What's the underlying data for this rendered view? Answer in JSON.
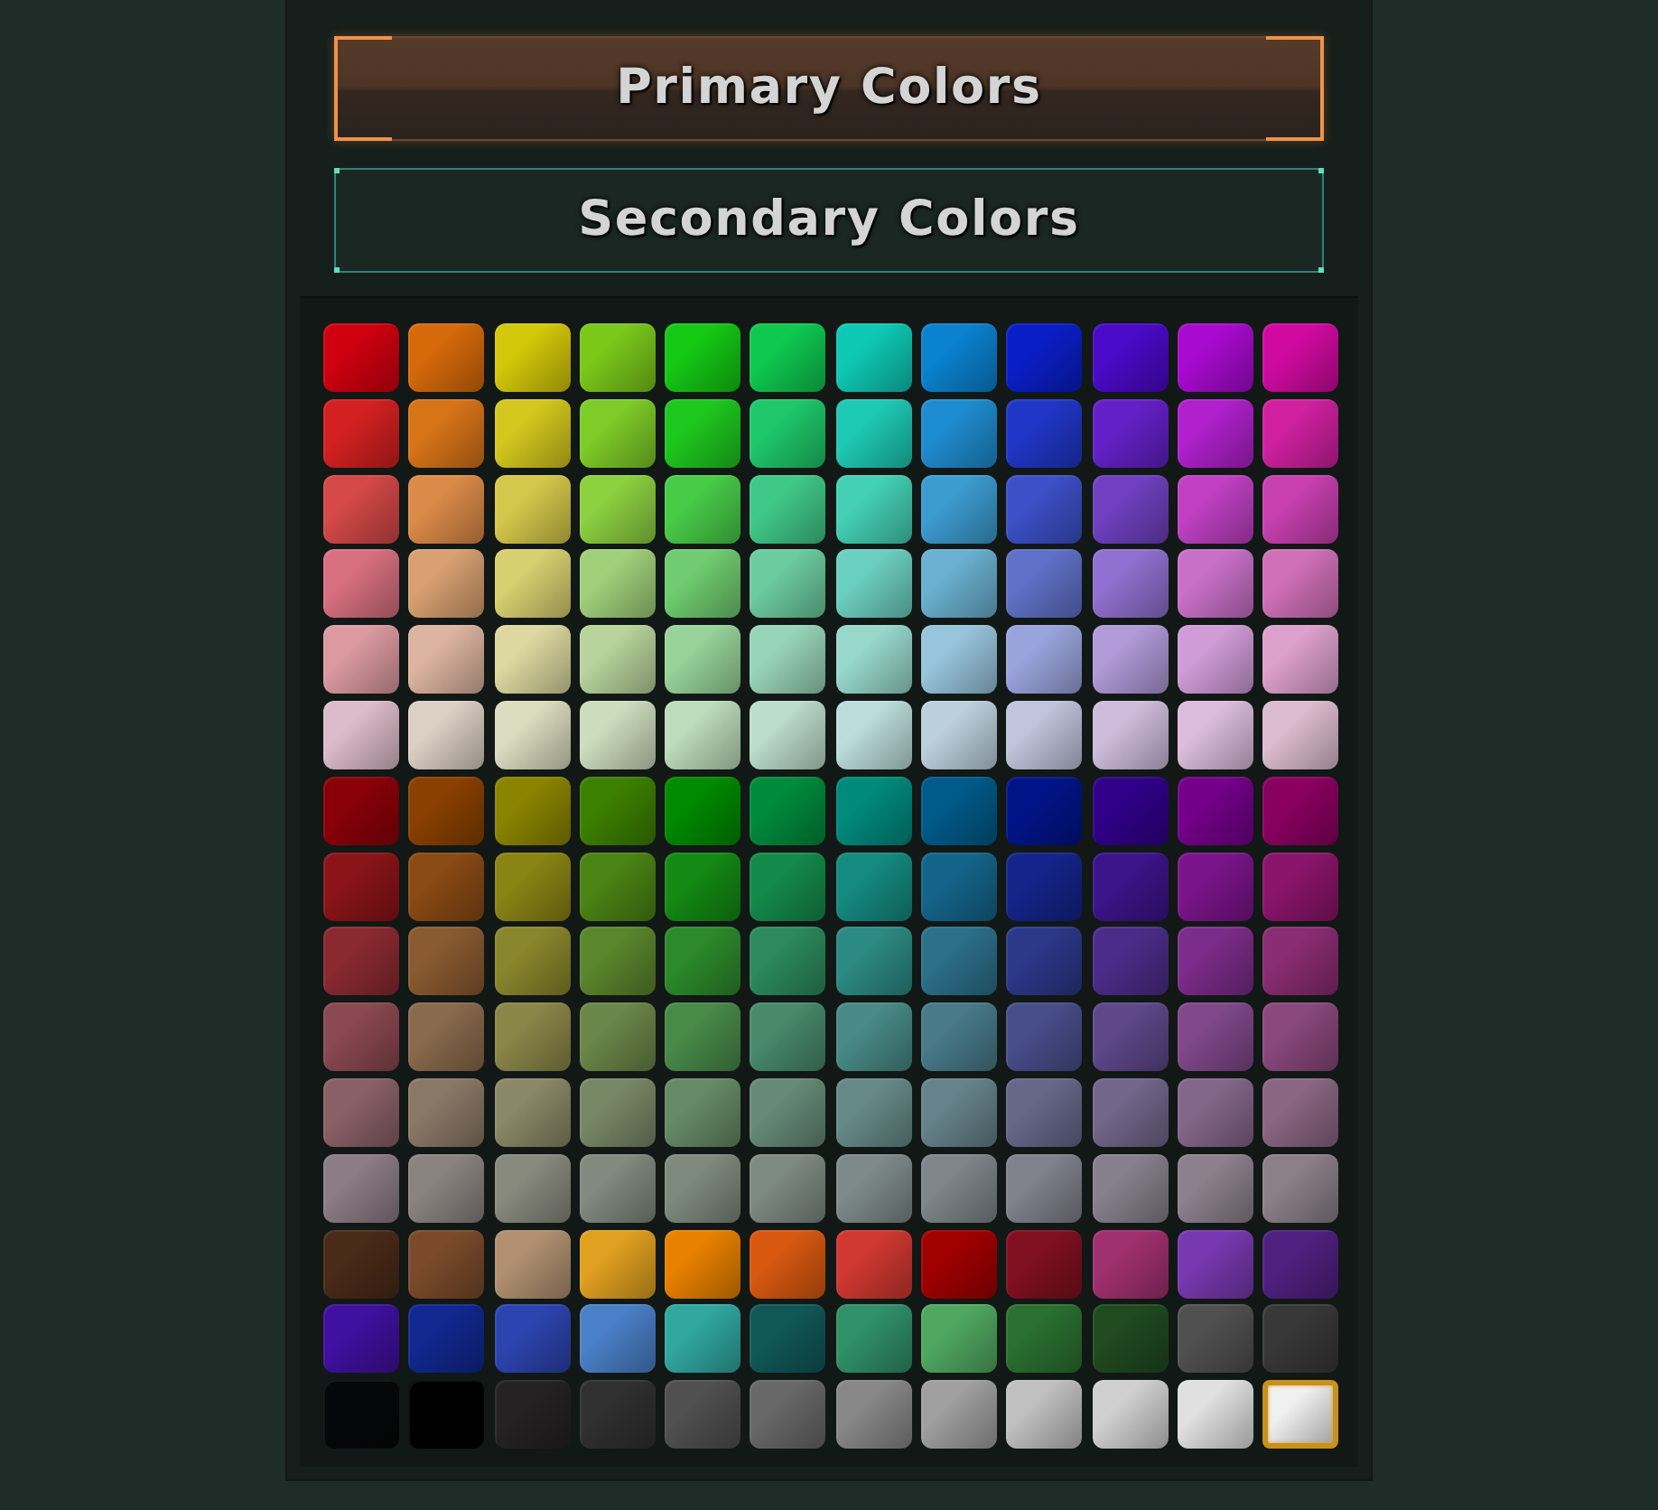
{
  "tabs": [
    {
      "label": "Primary Colors",
      "selected": true
    },
    {
      "label": "Secondary Colors",
      "selected": false
    }
  ],
  "swatches": [
    {
      "color": "#d0000f",
      "selected": false
    },
    {
      "color": "#d66a0a",
      "selected": false
    },
    {
      "color": "#d4c80a",
      "selected": false
    },
    {
      "color": "#7ac81a",
      "selected": false
    },
    {
      "color": "#14c814",
      "selected": false
    },
    {
      "color": "#0ec850",
      "selected": false
    },
    {
      "color": "#0ec8b4",
      "selected": false
    },
    {
      "color": "#0a82d0",
      "selected": false
    },
    {
      "color": "#0a1ec8",
      "selected": false
    },
    {
      "color": "#4a0ac8",
      "selected": false
    },
    {
      "color": "#a80ad0",
      "selected": false
    },
    {
      "color": "#d00aa0",
      "selected": false
    },
    {
      "color": "#d42020",
      "selected": false
    },
    {
      "color": "#d87418",
      "selected": false
    },
    {
      "color": "#d4c81e",
      "selected": false
    },
    {
      "color": "#7ecc28",
      "selected": false
    },
    {
      "color": "#1ec81e",
      "selected": false
    },
    {
      "color": "#1ec86a",
      "selected": false
    },
    {
      "color": "#1ecab4",
      "selected": false
    },
    {
      "color": "#1e8cd0",
      "selected": false
    },
    {
      "color": "#2036c8",
      "selected": false
    },
    {
      "color": "#6420c8",
      "selected": false
    },
    {
      "color": "#b020cc",
      "selected": false
    },
    {
      "color": "#d020a0",
      "selected": false
    },
    {
      "color": "#d44848",
      "selected": false
    },
    {
      "color": "#dc8a48",
      "selected": false
    },
    {
      "color": "#d4c84a",
      "selected": false
    },
    {
      "color": "#8cd040",
      "selected": false
    },
    {
      "color": "#48cc48",
      "selected": false
    },
    {
      "color": "#40c888",
      "selected": false
    },
    {
      "color": "#44d0b4",
      "selected": false
    },
    {
      "color": "#3c9cd0",
      "selected": false
    },
    {
      "color": "#3c50c8",
      "selected": false
    },
    {
      "color": "#7040c0",
      "selected": false
    },
    {
      "color": "#c040c4",
      "selected": false
    },
    {
      "color": "#c840b0",
      "selected": false
    },
    {
      "color": "#d87080",
      "selected": false
    },
    {
      "color": "#d8a070",
      "selected": false
    },
    {
      "color": "#d8d070",
      "selected": false
    },
    {
      "color": "#a0d07a",
      "selected": false
    },
    {
      "color": "#70cc70",
      "selected": false
    },
    {
      "color": "#6ccca0",
      "selected": false
    },
    {
      "color": "#6cd0c0",
      "selected": false
    },
    {
      "color": "#6ab0d0",
      "selected": false
    },
    {
      "color": "#6070c8",
      "selected": false
    },
    {
      "color": "#9070d0",
      "selected": false
    },
    {
      "color": "#c870c8",
      "selected": false
    },
    {
      "color": "#d070b8",
      "selected": false
    },
    {
      "color": "#dc9aa0",
      "selected": false
    },
    {
      "color": "#dcb4a0",
      "selected": false
    },
    {
      "color": "#dcd8a0",
      "selected": false
    },
    {
      "color": "#b8d49c",
      "selected": false
    },
    {
      "color": "#98d49a",
      "selected": false
    },
    {
      "color": "#98d4b8",
      "selected": false
    },
    {
      "color": "#98d8cc",
      "selected": false
    },
    {
      "color": "#98c4dc",
      "selected": false
    },
    {
      "color": "#9aa4dc",
      "selected": false
    },
    {
      "color": "#b09ad8",
      "selected": false
    },
    {
      "color": "#d09cd8",
      "selected": false
    },
    {
      "color": "#dca0cc",
      "selected": false
    },
    {
      "color": "#dcbcc8",
      "selected": false
    },
    {
      "color": "#dcd0c4",
      "selected": false
    },
    {
      "color": "#dcdcc0",
      "selected": false
    },
    {
      "color": "#ccdcbc",
      "selected": false
    },
    {
      "color": "#bcdcbc",
      "selected": false
    },
    {
      "color": "#bcdccc",
      "selected": false
    },
    {
      "color": "#bcdcdc",
      "selected": false
    },
    {
      "color": "#bcd0dc",
      "selected": false
    },
    {
      "color": "#c0c4dc",
      "selected": false
    },
    {
      "color": "#cebcdc",
      "selected": false
    },
    {
      "color": "#dcbcdc",
      "selected": false
    },
    {
      "color": "#dcbcd0",
      "selected": false
    },
    {
      "color": "#8a0008",
      "selected": false
    },
    {
      "color": "#8a4000",
      "selected": false
    },
    {
      "color": "#8a8400",
      "selected": false
    },
    {
      "color": "#3c8000",
      "selected": false
    },
    {
      "color": "#008a00",
      "selected": false
    },
    {
      "color": "#008a3c",
      "selected": false
    },
    {
      "color": "#008a7c",
      "selected": false
    },
    {
      "color": "#005a8a",
      "selected": false
    },
    {
      "color": "#001488",
      "selected": false
    },
    {
      "color": "#300088",
      "selected": false
    },
    {
      "color": "#74008a",
      "selected": false
    },
    {
      "color": "#8a0060",
      "selected": false
    },
    {
      "color": "#8a1418",
      "selected": false
    },
    {
      "color": "#8a4a14",
      "selected": false
    },
    {
      "color": "#8a8414",
      "selected": false
    },
    {
      "color": "#4a8414",
      "selected": false
    },
    {
      "color": "#148a14",
      "selected": false
    },
    {
      "color": "#148a4a",
      "selected": false
    },
    {
      "color": "#148a80",
      "selected": false
    },
    {
      "color": "#14648a",
      "selected": false
    },
    {
      "color": "#14248a",
      "selected": false
    },
    {
      "color": "#3c148a",
      "selected": false
    },
    {
      "color": "#7a148a",
      "selected": false
    },
    {
      "color": "#8a146a",
      "selected": false
    },
    {
      "color": "#8a2a30",
      "selected": false
    },
    {
      "color": "#8a5a30",
      "selected": false
    },
    {
      "color": "#8a862c",
      "selected": false
    },
    {
      "color": "#5a862c",
      "selected": false
    },
    {
      "color": "#2c8a2c",
      "selected": false
    },
    {
      "color": "#2c8a5c",
      "selected": false
    },
    {
      "color": "#2c8a84",
      "selected": false
    },
    {
      "color": "#2c708a",
      "selected": false
    },
    {
      "color": "#2c388a",
      "selected": false
    },
    {
      "color": "#4c2c8a",
      "selected": false
    },
    {
      "color": "#7c2c8a",
      "selected": false
    },
    {
      "color": "#8a2c72",
      "selected": false
    },
    {
      "color": "#8a4850",
      "selected": false
    },
    {
      "color": "#8a6a4c",
      "selected": false
    },
    {
      "color": "#8a8648",
      "selected": false
    },
    {
      "color": "#6a8648",
      "selected": false
    },
    {
      "color": "#488a48",
      "selected": false
    },
    {
      "color": "#488a6a",
      "selected": false
    },
    {
      "color": "#488a86",
      "selected": false
    },
    {
      "color": "#487a8a",
      "selected": false
    },
    {
      "color": "#484e8a",
      "selected": false
    },
    {
      "color": "#5e488a",
      "selected": false
    },
    {
      "color": "#80488a",
      "selected": false
    },
    {
      "color": "#8a487c",
      "selected": false
    },
    {
      "color": "#8a6068",
      "selected": false
    },
    {
      "color": "#8a7866",
      "selected": false
    },
    {
      "color": "#8a8866",
      "selected": false
    },
    {
      "color": "#788866",
      "selected": false
    },
    {
      "color": "#668a66",
      "selected": false
    },
    {
      "color": "#668a78",
      "selected": false
    },
    {
      "color": "#668a88",
      "selected": false
    },
    {
      "color": "#66828a",
      "selected": false
    },
    {
      "color": "#66688a",
      "selected": false
    },
    {
      "color": "#72668a",
      "selected": false
    },
    {
      "color": "#84668a",
      "selected": false
    },
    {
      "color": "#8a6682",
      "selected": false
    },
    {
      "color": "#8c7c84",
      "selected": false
    },
    {
      "color": "#8a8480",
      "selected": false
    },
    {
      "color": "#888a7e",
      "selected": false
    },
    {
      "color": "#808a7e",
      "selected": false
    },
    {
      "color": "#7e8a7e",
      "selected": false
    },
    {
      "color": "#7e8a84",
      "selected": false
    },
    {
      "color": "#7e8a8a",
      "selected": false
    },
    {
      "color": "#7e868a",
      "selected": false
    },
    {
      "color": "#80828c",
      "selected": false
    },
    {
      "color": "#86808c",
      "selected": false
    },
    {
      "color": "#8c808c",
      "selected": false
    },
    {
      "color": "#8c8088",
      "selected": false
    },
    {
      "color": "#4a2a18",
      "selected": false
    },
    {
      "color": "#7a4a2a",
      "selected": false
    },
    {
      "color": "#b09070",
      "selected": false
    },
    {
      "color": "#e0a020",
      "selected": false
    },
    {
      "color": "#e88000",
      "selected": false
    },
    {
      "color": "#d85810",
      "selected": false
    },
    {
      "color": "#d03830",
      "selected": false
    },
    {
      "color": "#a00000",
      "selected": false
    },
    {
      "color": "#801020",
      "selected": false
    },
    {
      "color": "#a03070",
      "selected": false
    },
    {
      "color": "#7838b0",
      "selected": false
    },
    {
      "color": "#502080",
      "selected": false
    },
    {
      "color": "#4010a0",
      "selected": false
    },
    {
      "color": "#102890",
      "selected": false
    },
    {
      "color": "#2c44b0",
      "selected": false
    },
    {
      "color": "#4a80c8",
      "selected": false
    },
    {
      "color": "#30a8a0",
      "selected": false
    },
    {
      "color": "#105858",
      "selected": false
    },
    {
      "color": "#30906a",
      "selected": false
    },
    {
      "color": "#50a860",
      "selected": false
    },
    {
      "color": "#2a7030",
      "selected": false
    },
    {
      "color": "#204a20",
      "selected": false
    },
    {
      "color": "#505050",
      "selected": false
    },
    {
      "color": "#383838",
      "selected": false
    },
    {
      "color": "#050808",
      "selected": false
    },
    {
      "color": "#000000",
      "selected": false
    },
    {
      "color": "#242222",
      "selected": false
    },
    {
      "color": "#303030",
      "selected": false
    },
    {
      "color": "#505050",
      "selected": false
    },
    {
      "color": "#686868",
      "selected": false
    },
    {
      "color": "#888888",
      "selected": false
    },
    {
      "color": "#a0a0a0",
      "selected": false
    },
    {
      "color": "#c0c0c0",
      "selected": false
    },
    {
      "color": "#d0d0d0",
      "selected": false
    },
    {
      "color": "#e0e0e0",
      "selected": false
    },
    {
      "color": "#f0f0f0",
      "selected": true
    }
  ]
}
